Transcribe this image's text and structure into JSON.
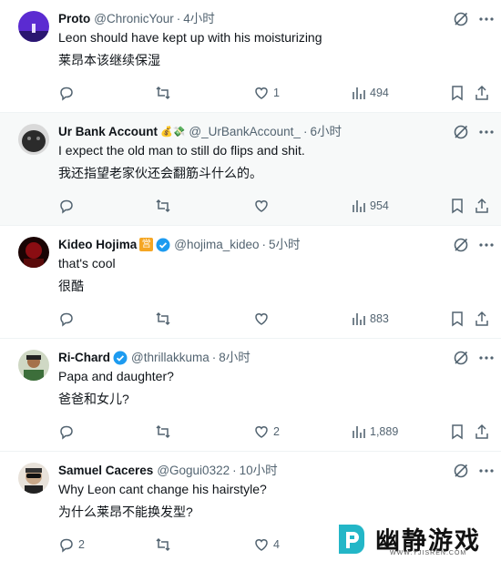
{
  "tweets": [
    {
      "name": "Proto",
      "handle": "@ChronicYour",
      "time": "4小时",
      "text_en": "Leon should have kept up with his moisturizing",
      "text_zh": "莱昂本该继续保湿",
      "reply_count": "",
      "like_count": "1",
      "views": "494",
      "avatar_color": "#5b2bd1"
    },
    {
      "name": "Ur Bank Account",
      "badge": "💰💸",
      "handle": "@_UrBankAccount_",
      "time": "6小时",
      "text_en": "I expect the old man to still do flips and shit.",
      "text_zh": "我还指望老家伙还会翻筋斗什么的。",
      "like_count": "",
      "views": "954",
      "avatar_color": "#2b2b2b"
    },
    {
      "name": "Kideo Hojima",
      "brand_badge": "営",
      "handle": "@hojima_kideo",
      "time": "5小时",
      "text_en": "that's cool",
      "text_zh": "很酷",
      "like_count": "",
      "views": "883",
      "avatar_color": "#8a0d12"
    },
    {
      "name": "Ri-Chard",
      "handle": "@thrillakkuma",
      "time": "8小时",
      "text_en": "Papa and daughter?",
      "text_zh": "爸爸和女儿?",
      "like_count": "2",
      "views": "1,889",
      "avatar_color": "#3c6e3a"
    },
    {
      "name": "Samuel Caceres",
      "handle": "@Gogui0322",
      "time": "10小时",
      "text_en": "Why Leon cant change his hairstyle?",
      "text_zh": "为什么莱昂不能换发型?",
      "reply_count": "2",
      "like_count": "4",
      "views": "",
      "avatar_color": "#c9a889"
    }
  ],
  "watermark": {
    "text": "幽静游戏",
    "url": "WWW.YJISREN.COM"
  },
  "colors": {
    "text": "#0f1419",
    "secondary": "#536471",
    "verified": "#1d9bf0",
    "highlight_bg": "#f7f9f9"
  }
}
